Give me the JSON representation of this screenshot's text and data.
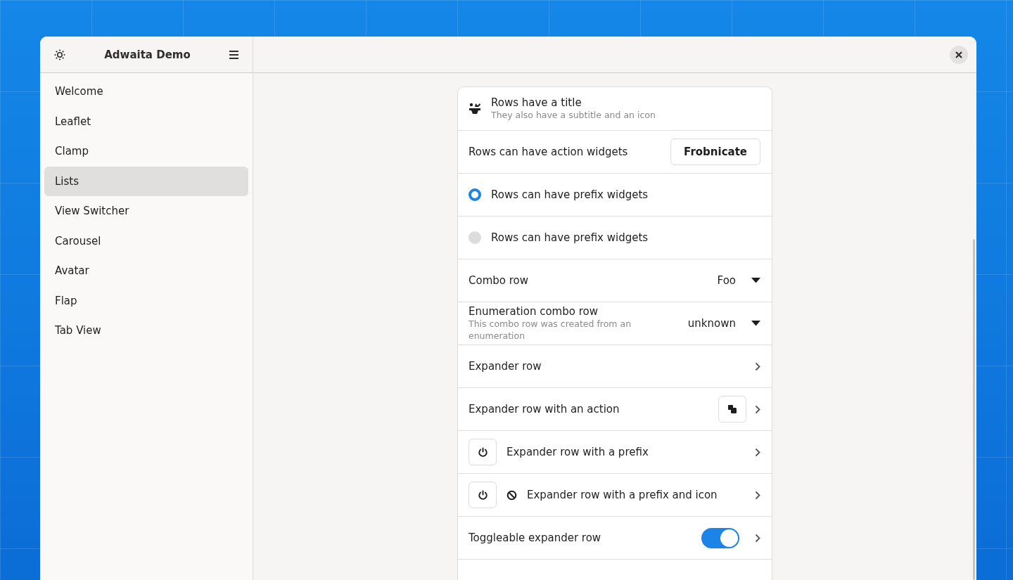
{
  "window": {
    "title": "Adwaita Demo"
  },
  "sidebar": {
    "items": [
      {
        "label": "Welcome",
        "selected": false
      },
      {
        "label": "Leaflet",
        "selected": false
      },
      {
        "label": "Clamp",
        "selected": false
      },
      {
        "label": "Lists",
        "selected": true
      },
      {
        "label": "View Switcher",
        "selected": false
      },
      {
        "label": "Carousel",
        "selected": false
      },
      {
        "label": "Avatar",
        "selected": false
      },
      {
        "label": "Flap",
        "selected": false
      },
      {
        "label": "Tab View",
        "selected": false
      }
    ]
  },
  "list": {
    "rows": [
      {
        "kind": "icon",
        "title": "Rows have a title",
        "subtitle": "They also have a subtitle and an icon"
      },
      {
        "kind": "button",
        "title": "Rows can have action widgets",
        "button": "Frobnicate"
      },
      {
        "kind": "radio",
        "title": "Rows can have prefix widgets",
        "selected": true
      },
      {
        "kind": "radio",
        "title": "Rows can have prefix widgets",
        "selected": false
      },
      {
        "kind": "combo",
        "title": "Combo row",
        "value": "Foo"
      },
      {
        "kind": "combo",
        "title": "Enumeration combo row",
        "subtitle": "This combo row was created from an enumeration",
        "value": "unknown"
      },
      {
        "kind": "expander",
        "title": "Expander row"
      },
      {
        "kind": "expander_action",
        "title": "Expander row with an action"
      },
      {
        "kind": "expander_prefix",
        "title": "Expander row with a prefix"
      },
      {
        "kind": "expander_prefix_icon",
        "title": "Expander row with a prefix and icon"
      },
      {
        "kind": "toggle",
        "title": "Toggleable expander row",
        "on": true
      },
      {
        "kind": "blank"
      }
    ]
  }
}
